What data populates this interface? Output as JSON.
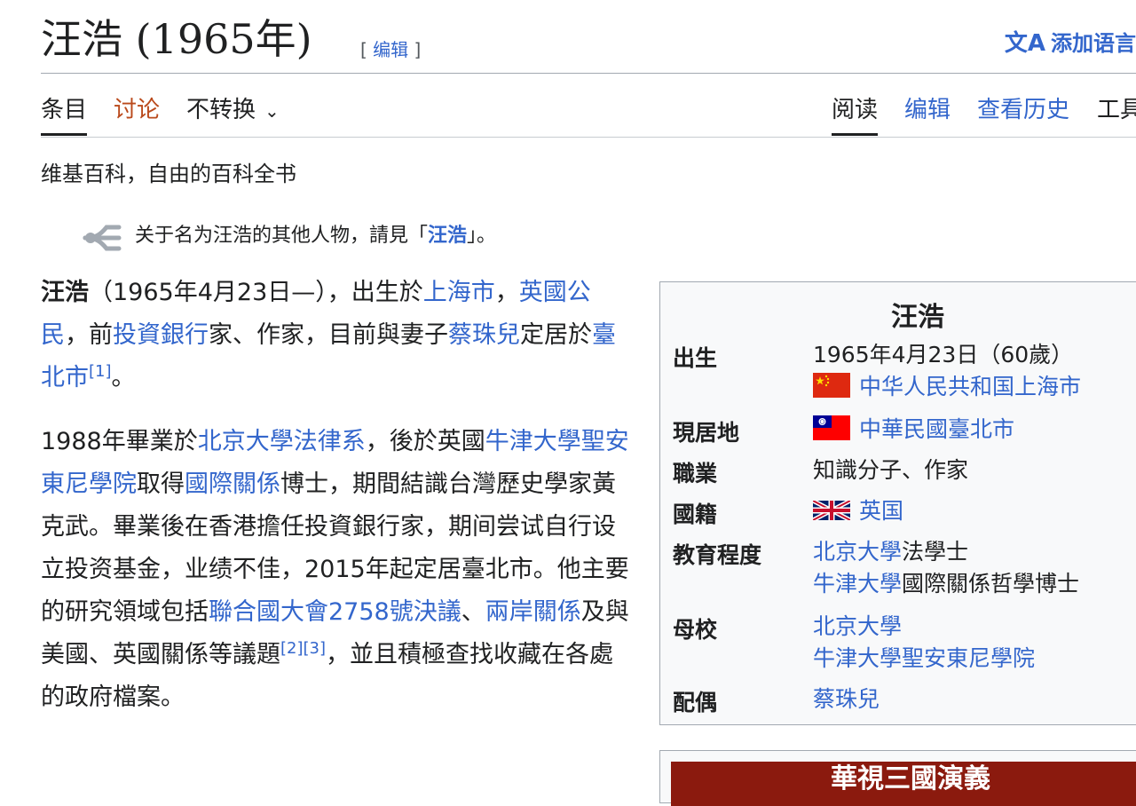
{
  "header": {
    "title": "汪浩 (1965年)",
    "edit_open": "[ ",
    "edit_label": "编辑",
    "edit_close": " ]",
    "add_languages": "添加语言"
  },
  "tabs": {
    "article": "条目",
    "talk": "讨论",
    "variant": "不转换",
    "read": "阅读",
    "edit": "编辑",
    "history": "查看历史",
    "tools": "工具"
  },
  "tagline": "维基百科，自由的百科全书",
  "hatnote": {
    "prefix": "关于名为汪浩的其他人物，請見「",
    "link": "汪浩",
    "suffix": "」。"
  },
  "intro": {
    "name": "汪浩",
    "t1": "（1965年4月23日—），出生於",
    "link_shanghai": "上海市",
    "t2": "，",
    "link_british": "英國公民",
    "t3": "，前",
    "link_ib": "投資銀行",
    "t4": "家、作家，目前與妻子",
    "link_wife": "蔡珠兒",
    "t5": "定居於",
    "link_taipei": "臺北市",
    "ref1": "[1]",
    "t6": "。"
  },
  "para2": {
    "t1": "1988年畢業於",
    "link_pku_law": "北京大學法律系",
    "t2": "，後於英國",
    "link_oxford_sant": "牛津大學聖安東尼學院",
    "t3": "取得",
    "link_ir": "國際關係",
    "t4": "博士，期間結識台灣歷史學家黃克武。畢業後在香港擔任投資銀行家，期间尝试自行设立投资基金，业绩不佳，2015年起定居臺北市。他主要的研究領域包括",
    "link_un2758": "聯合國大會2758號決議",
    "t5": "、",
    "link_cross": "兩岸關係",
    "t6": "及與美國、英國關係等議題",
    "ref2": "[2]",
    "ref3": "[3]",
    "t7": "，並且積極查找收藏在各處的政府檔案。"
  },
  "infobox": {
    "title": "汪浩",
    "born_label": "出生",
    "born_date": "1965年4月23日（60歲）",
    "born_place": "中华人民共和国上海市",
    "residence_label": "現居地",
    "residence": "中華民國臺北市",
    "occupation_label": "職業",
    "occupation": "知識分子、作家",
    "nationality_label": "國籍",
    "nationality": "英国",
    "education_label": "教育程度",
    "edu1_link": "北京大學",
    "edu1_text": "法學士",
    "edu2_link": "牛津大學",
    "edu2_text": "國際關係哲學博士",
    "alma_label": "母校",
    "alma1": "北京大學",
    "alma2": "牛津大學聖安東尼學院",
    "spouse_label": "配偶",
    "spouse": "蔡珠兒"
  },
  "infobox2": {
    "header": "華視三國演義"
  },
  "icons": {
    "hatnote": "disambig-fork-icon",
    "translate": "translate-icon",
    "chevron": "chevron-down-icon"
  },
  "colors": {
    "link": "#3366cc",
    "talk": "#ba4a1c",
    "infobox_bg": "#f8f9fa",
    "navbox_header": "#8b1a0e"
  }
}
